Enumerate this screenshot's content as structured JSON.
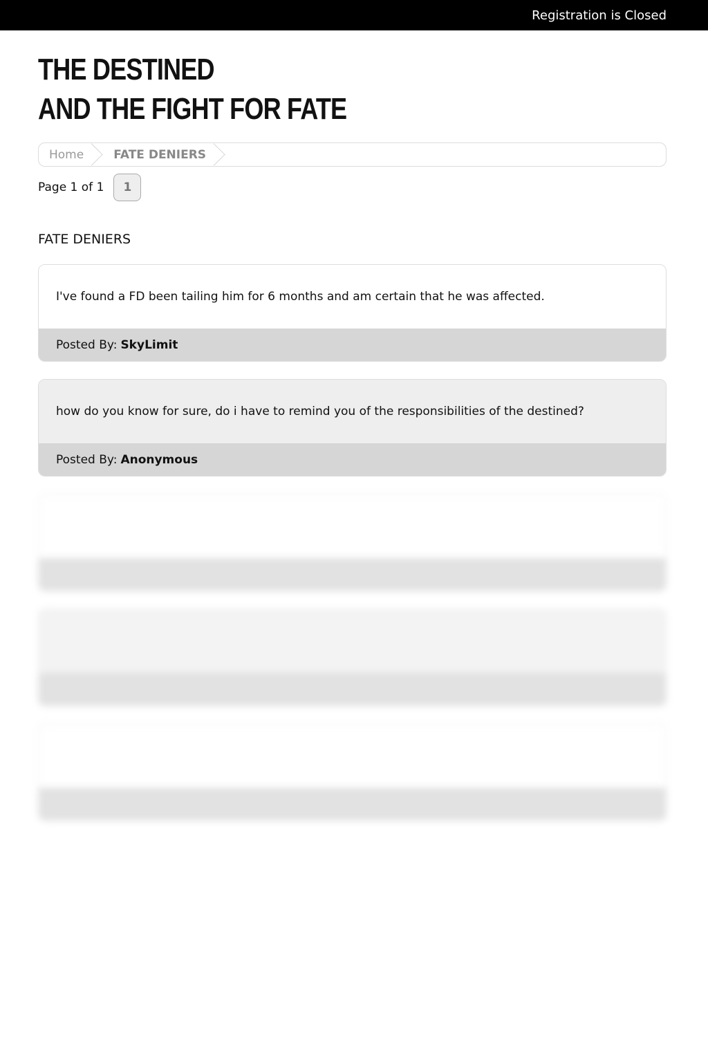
{
  "topbar": {
    "registration_text": "Registration is Closed"
  },
  "site": {
    "title_line1": "THE DESTINED",
    "title_line2": "AND THE FIGHT FOR  FATE"
  },
  "breadcrumb": {
    "items": [
      "Home",
      "FATE DENIERS"
    ]
  },
  "pagination": {
    "label": "Page 1 of 1",
    "pages": [
      "1"
    ]
  },
  "forum": {
    "title": "FATE DENIERS"
  },
  "posts": [
    {
      "text": "I've found a FD been tailing him for 6 months and am certain that he was affected.",
      "posted_by_label": "Posted By:",
      "author": "SkyLimit"
    },
    {
      "text": "how do you know for sure, do i have to remind you of the responsibilities of the destined?",
      "posted_by_label": "Posted By:",
      "author": "Anonymous"
    }
  ]
}
